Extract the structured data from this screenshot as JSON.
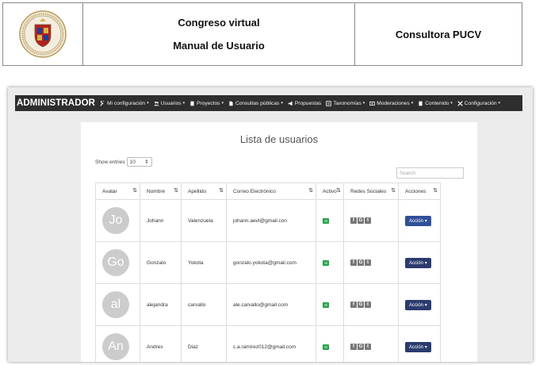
{
  "document": {
    "title_line1": "Congreso virtual",
    "title_line2": "Manual de Usuario",
    "company": "Consultora PUCV"
  },
  "navbar": {
    "brand": "ADMINISTRADOR",
    "items": [
      {
        "label": "Mi configuración",
        "icon": "wrench-icon"
      },
      {
        "label": "Usuarios",
        "icon": "users-icon"
      },
      {
        "label": "Proyectos",
        "icon": "file-icon"
      },
      {
        "label": "Consultas públicas",
        "icon": "document-icon"
      },
      {
        "label": "Propuestas",
        "icon": "megaphone-icon"
      },
      {
        "label": "Taxonomías",
        "icon": "list-icon"
      },
      {
        "label": "Moderaciones",
        "icon": "moderation-icon"
      },
      {
        "label": "Contenido",
        "icon": "page-icon"
      },
      {
        "label": "Configuración",
        "icon": "tools-icon"
      }
    ]
  },
  "panel": {
    "title": "Lista de usuarios",
    "show_entries_label": "Show entries",
    "entries_value": "10",
    "search_placeholder": "Search"
  },
  "table": {
    "headers": [
      "Avatar",
      "Nombre",
      "Apellido",
      "Correo Electrónico",
      "Activo",
      "Redes Sociales",
      "Acciones"
    ],
    "rows": [
      {
        "initials": "Jo",
        "nombre": "Johann",
        "apellido": "Valenzuela",
        "correo": "johann.aevt@gmail.con",
        "activo": "Sí",
        "accion": "Acción"
      },
      {
        "initials": "Go",
        "nombre": "Gonzalo",
        "apellido": "Yokota",
        "correo": "gonzalo.yokota@gmail.com",
        "activo": "Sí",
        "accion": "Acción"
      },
      {
        "initials": "al",
        "nombre": "alejandra",
        "apellido": "carvallo",
        "correo": "ale.carvallo@gmail.com",
        "activo": "Sí",
        "accion": "Acción"
      },
      {
        "initials": "An",
        "nombre": "Andres",
        "apellido": "Diaz",
        "correo": "c.a.ramirez012@gmail.com",
        "activo": "Sí",
        "accion": "Acción"
      }
    ]
  },
  "colors": {
    "navbar_bg": "#2e2e2e",
    "badge_green": "#24a24a",
    "button_blue": "#2b3b6e",
    "avatar_gray": "#cccccc"
  }
}
